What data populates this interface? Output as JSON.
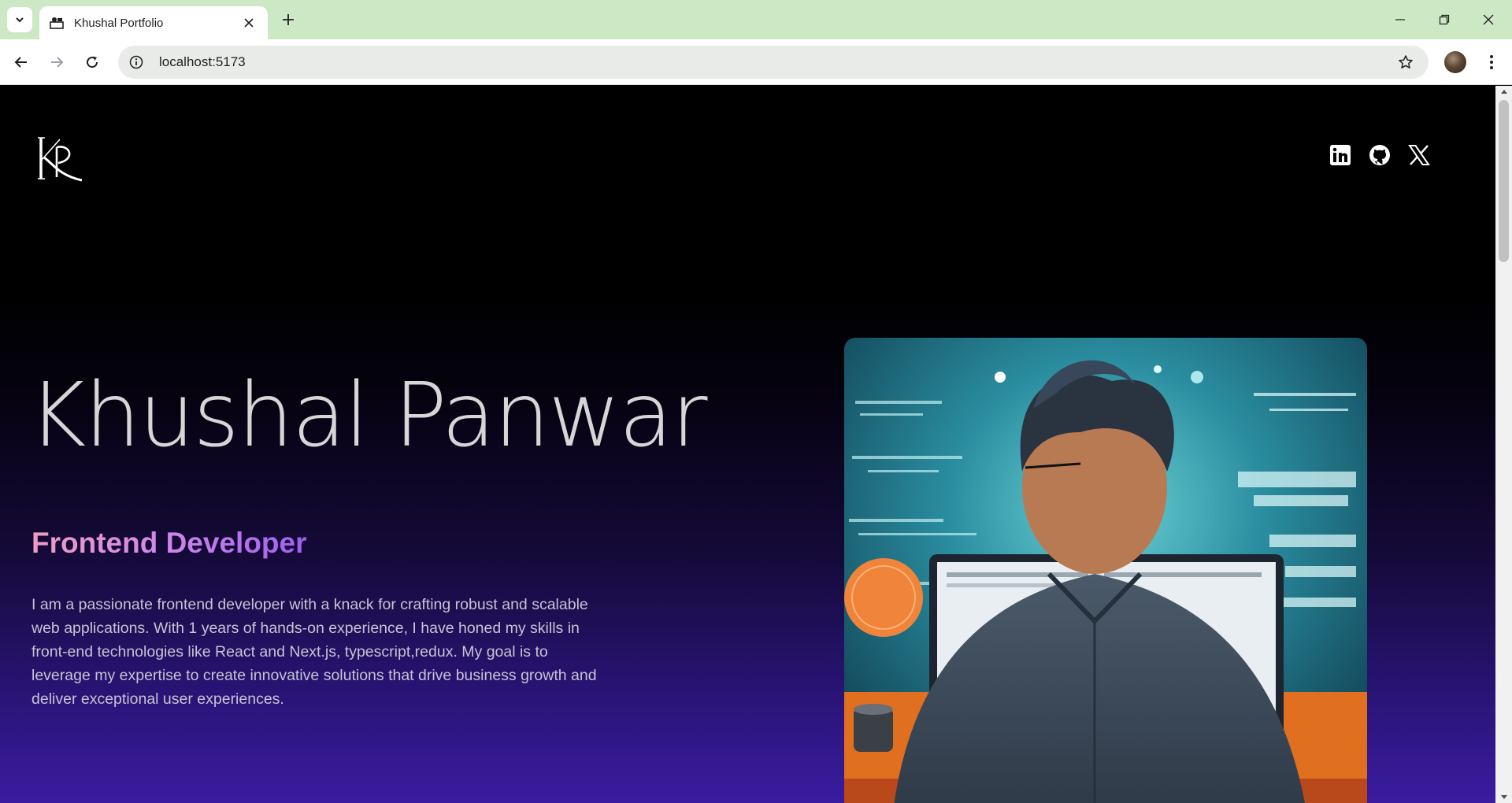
{
  "browser": {
    "tab_title": "Khushal Portfolio",
    "url": "localhost:5173",
    "icons": {
      "tab_search": "chevron-down-icon",
      "favicon": "portfolio-favicon",
      "close": "close-icon",
      "new_tab": "plus-icon",
      "back": "back-arrow-icon",
      "forward": "forward-arrow-icon",
      "reload": "reload-icon",
      "site_info": "info-icon",
      "bookmark": "star-icon",
      "menu": "kebab-menu-icon"
    }
  },
  "header": {
    "logo_text": "KP",
    "socials": [
      {
        "name": "LinkedIn",
        "icon": "linkedin-icon"
      },
      {
        "name": "GitHub",
        "icon": "github-icon"
      },
      {
        "name": "X",
        "icon": "x-icon"
      }
    ]
  },
  "hero": {
    "name": "Khushal Panwar",
    "role": "Frontend Developer",
    "bio": "I am a passionate frontend developer with a knack for crafting robust and scalable web applications. With 1 years of hands-on experience, I have honed my skills in front-end technologies like React and Next.js, typescript,redux. My goal is to leverage my expertise to create innovative solutions that drive business growth and deliver exceptional user experiences."
  },
  "colors": {
    "tabbar": "#cde8c4",
    "page_bg_top": "#000000",
    "page_bg_bottom": "#3a1ca0",
    "role_gradient_start": "#f09cc2",
    "role_gradient_end": "#a05ef0"
  }
}
